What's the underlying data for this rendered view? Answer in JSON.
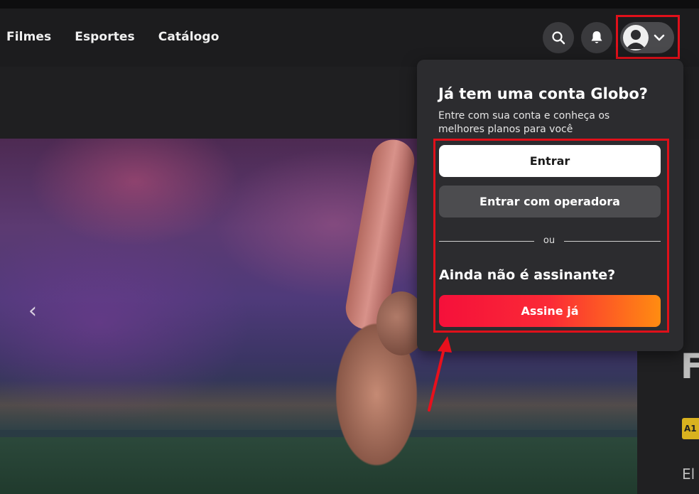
{
  "nav": {
    "items": [
      {
        "label": "Filmes"
      },
      {
        "label": "Esportes"
      },
      {
        "label": "Catálogo"
      }
    ]
  },
  "header_icons": {
    "search": "search-icon",
    "notifications": "bell-icon",
    "profile": "user-avatar-icon",
    "chevron": "chevron-down-icon"
  },
  "dropdown": {
    "title": "Já tem uma conta Globo?",
    "subtitle": "Entre com sua conta e conheça os melhores planos para você",
    "login_label": "Entrar",
    "operator_label": "Entrar com operadora",
    "separator": "ou",
    "question": "Ainda não é assinante?",
    "subscribe_label": "Assine já"
  },
  "colors": {
    "highlight": "#e0101a",
    "subscribe_gradient_start": "#f5103a",
    "subscribe_gradient_end": "#ff8c11",
    "background": "#1b1b1d"
  }
}
